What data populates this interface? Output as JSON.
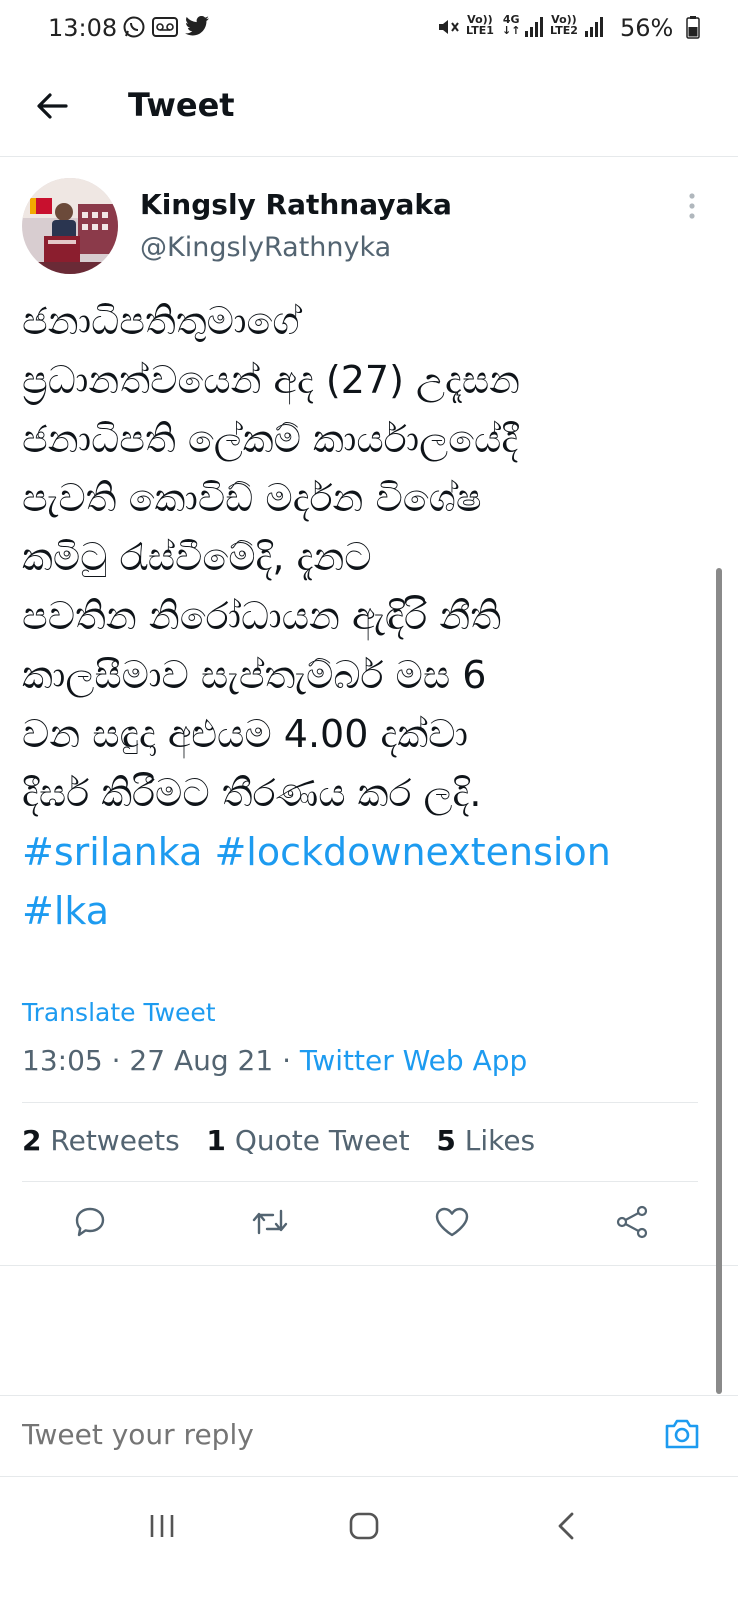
{
  "status_bar": {
    "time": "13:08",
    "left_icons": [
      "whatsapp-icon",
      "voicemail-icon",
      "twitter-bird-icon"
    ],
    "right_icons": [
      "mute-icon",
      "volte-lte1-icon",
      "4g-icon",
      "signal-1-icon",
      "volte-lte2-icon",
      "signal-2-icon"
    ],
    "battery": "56%"
  },
  "header": {
    "title": "Tweet"
  },
  "tweet": {
    "author_name": "Kingsly Rathnayaka",
    "author_handle": "@KingslyRathnyka",
    "body_lines": [
      "ජනාධිපතිතුමාගේ",
      "ප්‍රධානත්වයෙන් අද (27) උදෑසන",
      "ජනාධිපති ලේකම් කාර්යාලයේදී",
      "පැවති කොවිඩ් මර්දන විශේෂ",
      "කමිටු රැස්වීමේදි, දැනට",
      "පවතින නිරෝධායන ඇඳිරි නීති",
      "කාලසීමාව සැප්තැම්බර් මස 6",
      "වන සඳුදා අළුයම 4.00 දක්වා",
      "දීර්ඝ කිරීමට තීරණය කර ලදි."
    ],
    "hashtags_line1": "#srilanka #lockdownextension",
    "hashtags_line2": "#lka",
    "translate_label": "Translate Tweet",
    "time": "13:05",
    "date": "27 Aug 21",
    "separator": "·",
    "source_app": "Twitter Web App"
  },
  "stats": {
    "retweets_count": "2",
    "retweets_label": "Retweets",
    "quotes_count": "1",
    "quotes_label": "Quote Tweet",
    "likes_count": "5",
    "likes_label": "Likes"
  },
  "actions": [
    "reply-icon",
    "retweet-icon",
    "like-icon",
    "share-icon"
  ],
  "reply": {
    "placeholder": "Tweet your reply"
  },
  "nav": [
    "recents-icon",
    "home-icon",
    "back-icon"
  ],
  "colors": {
    "accent": "#1d9bf0",
    "secondary_text": "#536471",
    "primary_text": "#0f1419"
  }
}
